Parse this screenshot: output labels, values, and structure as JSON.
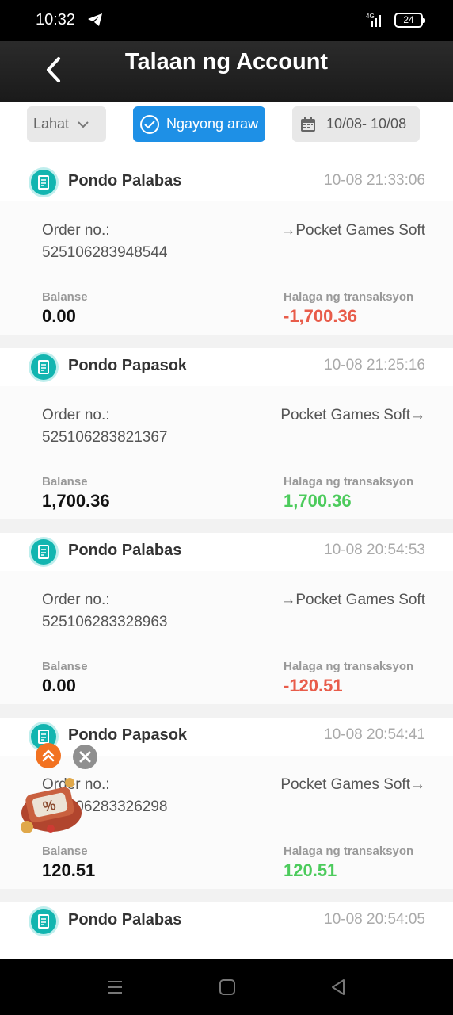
{
  "status_bar": {
    "time": "10:32",
    "network": "4G",
    "battery": "24"
  },
  "header": {
    "title": "Talaan ng Account"
  },
  "filters": {
    "type_select": "Lahat",
    "today_button": "Ngayong araw",
    "date_range": "10/08- 10/08"
  },
  "labels": {
    "order_no": "Order no.:",
    "balance": "Balanse",
    "amount": "Halaga ng transaksyon"
  },
  "transactions": [
    {
      "type": "Pondo Palabas",
      "time": "10-08 21:33:06",
      "order_no": "525106283948544",
      "destination": "→Pocket Games Soft",
      "balance": "0.00",
      "amount": "-1,700.36",
      "direction": "out"
    },
    {
      "type": "Pondo Papasok",
      "time": "10-08 21:25:16",
      "order_no": "525106283821367",
      "destination": "Pocket Games Soft→",
      "balance": "1,700.36",
      "amount": "1,700.36",
      "direction": "in"
    },
    {
      "type": "Pondo Palabas",
      "time": "10-08 20:54:53",
      "order_no": "525106283328963",
      "destination": "→Pocket Games Soft",
      "balance": "0.00",
      "amount": "-120.51",
      "direction": "out"
    },
    {
      "type": "Pondo Papasok",
      "time": "10-08 20:54:41",
      "order_no": "525106283326298",
      "destination": "Pocket Games Soft→",
      "balance": "120.51",
      "amount": "120.51",
      "direction": "in"
    },
    {
      "type": "Pondo Palabas",
      "time": "10-08 20:54:05"
    }
  ],
  "colors": {
    "accent": "#1e90e6",
    "negative": "#e85c4a",
    "positive": "#4ccb5c",
    "icon": "#12b5b0"
  },
  "icons": [
    "telegram-icon",
    "signal-icon",
    "battery-icon",
    "back-arrow-icon",
    "chevron-down-icon",
    "check-circle-icon",
    "calendar-icon",
    "receipt-icon",
    "double-chevron-up-icon",
    "close-icon",
    "promo-gift-icon",
    "menu-icon",
    "home-icon",
    "back-triangle-icon"
  ]
}
